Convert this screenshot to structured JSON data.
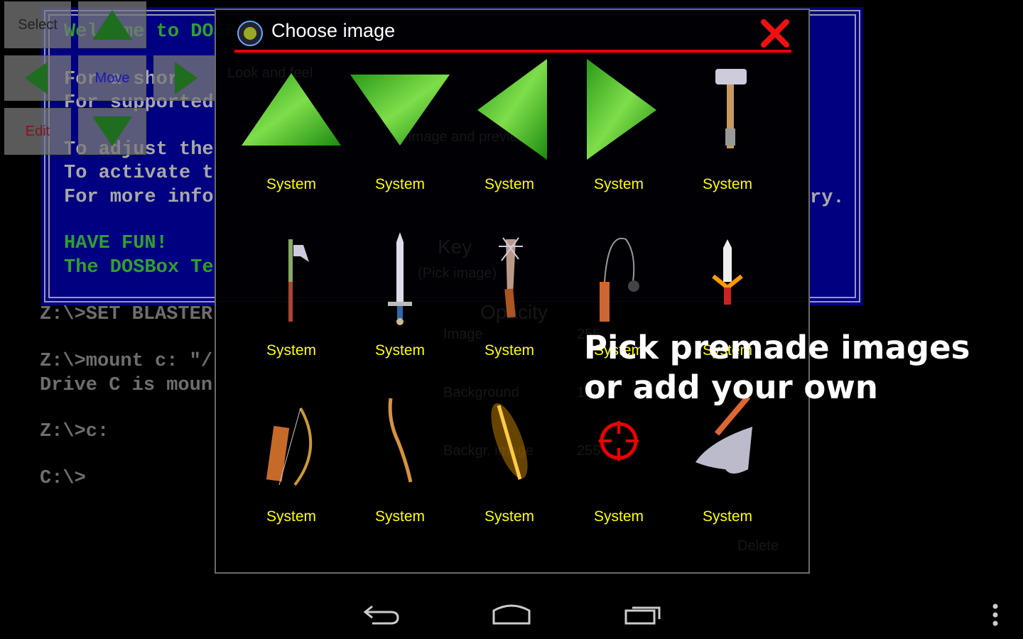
{
  "dos_window": {
    "lines": [
      {
        "text": "Welcome to DOSBox",
        "green": true
      },
      {
        "text": "For a short",
        "green": false
      },
      {
        "text": "For supported",
        "green": false
      },
      {
        "text": "To adjust the",
        "green": false
      },
      {
        "text": "To activate t",
        "green": false
      },
      {
        "text": "For more info",
        "green": false
      },
      {
        "text": "HAVE FUN!",
        "green": true
      },
      {
        "text": "The DOSBox Te",
        "green": true
      }
    ],
    "line_tail": "ry."
  },
  "terminal": [
    "Z:\\>SET BLASTER",
    "Z:\\>mount c: \"/",
    "Drive C is moun",
    "Z:\\>c:",
    "C:\\>"
  ],
  "controls": {
    "select": "Select",
    "move": "Move",
    "edit": "Edit"
  },
  "dialog": {
    "title": "Choose image",
    "close_icon": "close-x-icon",
    "accent_color": "#ee0000",
    "label_color": "#ffff00",
    "items": [
      {
        "icon": "green-arrow-up",
        "label": "System"
      },
      {
        "icon": "green-arrow-down",
        "label": "System"
      },
      {
        "icon": "green-arrow-left",
        "label": "System"
      },
      {
        "icon": "green-arrow-right",
        "label": "System"
      },
      {
        "icon": "hammer",
        "label": "System"
      },
      {
        "icon": "axe",
        "label": "System"
      },
      {
        "icon": "sword",
        "label": "System"
      },
      {
        "icon": "spiked-club",
        "label": "System"
      },
      {
        "icon": "flail",
        "label": "System"
      },
      {
        "icon": "dagger",
        "label": "System"
      },
      {
        "icon": "bow-and-quiver",
        "label": "System"
      },
      {
        "icon": "bow",
        "label": "System"
      },
      {
        "icon": "flaming-sword",
        "label": "System"
      },
      {
        "icon": "crosshair",
        "label": "System"
      },
      {
        "icon": "anvil-hammer",
        "label": "System"
      }
    ],
    "background_ghost_text": [
      "Look and feel",
      "Image and preview",
      "Key",
      "(Pick image)",
      "Opacity",
      "Image",
      "255",
      "Background",
      "100",
      "Backgr. image",
      "255",
      "Delete"
    ]
  },
  "promo_text": "Pick premade images\nor add your own",
  "navbar": {
    "back": "back-icon",
    "home": "home-icon",
    "recents": "recents-icon",
    "menu": "overflow-menu-icon"
  }
}
